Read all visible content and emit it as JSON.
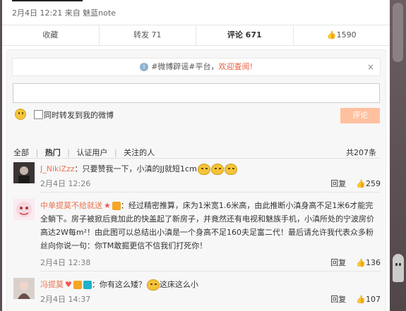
{
  "post": {
    "meta": "2月4日 12:21 来自 魅蓝note"
  },
  "actions": {
    "favorite": "收藏",
    "repost": "转发 71",
    "comment": "评论 671",
    "like": "1590"
  },
  "notice": {
    "text": "#微博辟谣#平台，",
    "link": "欢迎查阅!",
    "close": "×"
  },
  "composer": {
    "placeholder": "",
    "forward_label": "同时转发到我的微博",
    "submit_label": "评论"
  },
  "filters": {
    "all": "全部",
    "hot": "热门",
    "verified": "认证用户",
    "following": "关注的人",
    "total": "共207条"
  },
  "comments": [
    {
      "user": "J_NikiZzz",
      "text": "：只要赞我一下，小滇的JJ就短1cm",
      "date": "2月4日 12:26",
      "reply": "回复",
      "likes": "259"
    },
    {
      "user": "中单提莫不给就送",
      "text1": "：经过精密推算，床为1米宽1.6米高，由此推断小滇身高不足1米6才能完全躺下。房子被掀后竟加此的快盖起了新房子，并竟然还有电视和魅族手机，小滇所处的宁波房价高达2W每m²！由此图可以总结出小滇是一个身高不足160夫足富二代！最后请允许我代表众多粉丝向你说一句：你TM敢掘更信不信我们打死你！",
      "date": "2月4日 12:38",
      "reply": "回复",
      "likes": "136"
    },
    {
      "user": "冯提莫",
      "text": "：你有这么矮？",
      "text_after": "这床这么小",
      "date": "2月4日 14:37",
      "reply": "回复",
      "likes": "107"
    }
  ],
  "colors": {
    "accent": "#eb7350",
    "button": "#ffc09f",
    "link": "#e8593b"
  }
}
